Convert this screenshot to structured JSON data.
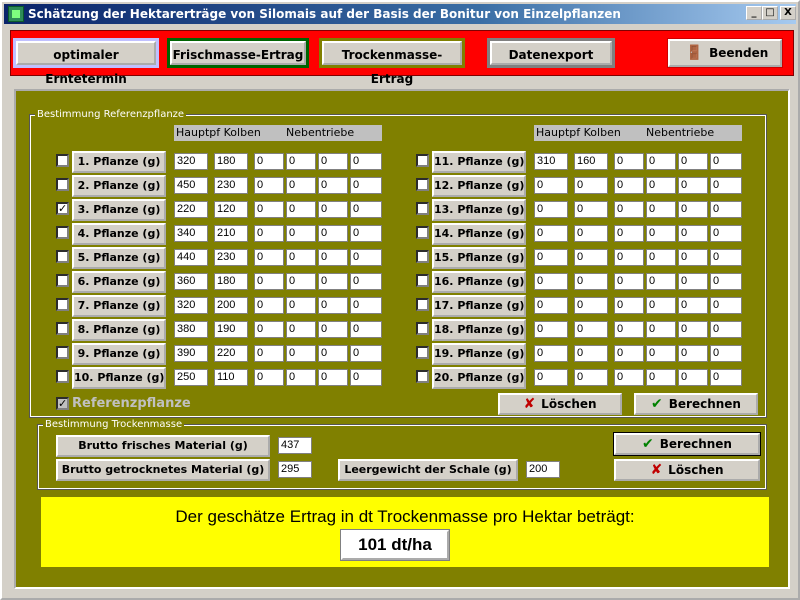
{
  "window": {
    "title": "Schätzung der Hektarerträge von Silomais auf der Basis der Bonitur von Einzelpflanzen",
    "controls": {
      "minimize": "_",
      "maximize": "□",
      "close": "X"
    }
  },
  "toolbar": {
    "harvest": "optimaler Erntetermin",
    "fresh": "Frischmasse-Ertrag",
    "dry": "Trockenmasse-Ertrag",
    "export": "Datenexport",
    "exit": "Beenden"
  },
  "reference": {
    "group_title": "Bestimmung Referenzpflanze",
    "headers": {
      "main": "Hauptpf Kolben",
      "side": "Nebentriebe"
    },
    "plants": [
      {
        "label": "1. Pflanze (g)",
        "checked": false,
        "values": [
          "320",
          "180",
          "0",
          "0",
          "0",
          "0"
        ]
      },
      {
        "label": "2. Pflanze (g)",
        "checked": false,
        "values": [
          "450",
          "230",
          "0",
          "0",
          "0",
          "0"
        ]
      },
      {
        "label": "3. Pflanze (g)",
        "checked": true,
        "values": [
          "220",
          "120",
          "0",
          "0",
          "0",
          "0"
        ]
      },
      {
        "label": "4. Pflanze (g)",
        "checked": false,
        "values": [
          "340",
          "210",
          "0",
          "0",
          "0",
          "0"
        ]
      },
      {
        "label": "5. Pflanze (g)",
        "checked": false,
        "values": [
          "440",
          "230",
          "0",
          "0",
          "0",
          "0"
        ]
      },
      {
        "label": "6. Pflanze (g)",
        "checked": false,
        "values": [
          "360",
          "180",
          "0",
          "0",
          "0",
          "0"
        ]
      },
      {
        "label": "7. Pflanze (g)",
        "checked": false,
        "values": [
          "320",
          "200",
          "0",
          "0",
          "0",
          "0"
        ]
      },
      {
        "label": "8. Pflanze (g)",
        "checked": false,
        "values": [
          "380",
          "190",
          "0",
          "0",
          "0",
          "0"
        ]
      },
      {
        "label": "9. Pflanze (g)",
        "checked": false,
        "values": [
          "390",
          "220",
          "0",
          "0",
          "0",
          "0"
        ]
      },
      {
        "label": "10. Pflanze (g)",
        "checked": false,
        "values": [
          "250",
          "110",
          "0",
          "0",
          "0",
          "0"
        ]
      },
      {
        "label": "11. Pflanze (g)",
        "checked": false,
        "values": [
          "310",
          "160",
          "0",
          "0",
          "0",
          "0"
        ]
      },
      {
        "label": "12. Pflanze (g)",
        "checked": false,
        "values": [
          "0",
          "0",
          "0",
          "0",
          "0",
          "0"
        ]
      },
      {
        "label": "13. Pflanze (g)",
        "checked": false,
        "values": [
          "0",
          "0",
          "0",
          "0",
          "0",
          "0"
        ]
      },
      {
        "label": "14. Pflanze (g)",
        "checked": false,
        "values": [
          "0",
          "0",
          "0",
          "0",
          "0",
          "0"
        ]
      },
      {
        "label": "15. Pflanze (g)",
        "checked": false,
        "values": [
          "0",
          "0",
          "0",
          "0",
          "0",
          "0"
        ]
      },
      {
        "label": "16. Pflanze (g)",
        "checked": false,
        "values": [
          "0",
          "0",
          "0",
          "0",
          "0",
          "0"
        ]
      },
      {
        "label": "17. Pflanze (g)",
        "checked": false,
        "values": [
          "0",
          "0",
          "0",
          "0",
          "0",
          "0"
        ]
      },
      {
        "label": "18. Pflanze (g)",
        "checked": false,
        "values": [
          "0",
          "0",
          "0",
          "0",
          "0",
          "0"
        ]
      },
      {
        "label": "19. Pflanze (g)",
        "checked": false,
        "values": [
          "0",
          "0",
          "0",
          "0",
          "0",
          "0"
        ]
      },
      {
        "label": "20. Pflanze (g)",
        "checked": false,
        "values": [
          "0",
          "0",
          "0",
          "0",
          "0",
          "0"
        ]
      }
    ],
    "ref_checkbox_label": "Referenzpflanze",
    "ref_checkbox_checked": true,
    "delete_label": "Löschen",
    "calc_label": "Berechnen"
  },
  "drymass": {
    "group_title": "Bestimmung Trockenmasse",
    "gross_fresh_label": "Brutto frisches Material (g)",
    "gross_fresh_value": "437",
    "gross_dry_label": "Brutto getrocknetes Material (g)",
    "gross_dry_value": "295",
    "tare_label": "Leergewicht der Schale (g)",
    "tare_value": "200",
    "calc_label": "Berechnen",
    "delete_label": "Löschen"
  },
  "result": {
    "text": "Der geschätze Ertrag in dt Trockenmasse pro Hektar beträgt:",
    "value": "101 dt/ha"
  },
  "icons": {
    "delete": "x-icon",
    "calc": "check-icon",
    "exit": "person-door-icon",
    "app": "app-icon"
  },
  "colors": {
    "titlebar": "#0a246a",
    "toolbar_bg": "#ff0000",
    "panel_bg": "#808000",
    "result_bg": "#ffff00"
  }
}
